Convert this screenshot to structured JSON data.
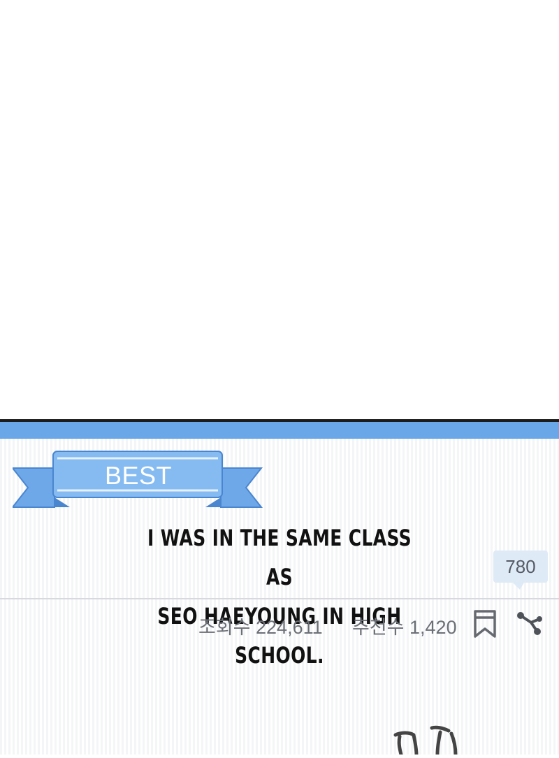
{
  "post": {
    "badge_label": "BEST",
    "caption_line1": "I WAS IN THE SAME CLASS AS",
    "caption_line2": "SEO HAEYOUNG IN HIGH SCHOOL.",
    "comment_count": "780",
    "views_text": "조회수 224,611",
    "recommend_text": "추천수 1,420"
  },
  "icons": {
    "bookmark": "bookmark-icon",
    "share": "share-icon"
  },
  "colors": {
    "accent_bar": "#6aa7e8",
    "ribbon": "#7fb4ee",
    "comment_bubble": "#dfeaf7",
    "stat_text": "#6b6f76"
  }
}
